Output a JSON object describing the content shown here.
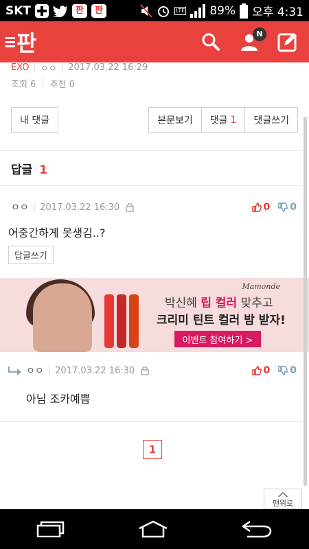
{
  "status_bar": {
    "carrier": "SKT",
    "battery": "89%",
    "time": "오후 4:31",
    "net_badge": "LTE"
  },
  "app": {
    "logo": "판",
    "notification_badge": "N"
  },
  "post_meta": {
    "category": "EXO",
    "author": "ㅇㅇ",
    "date": "2017.03.22 16:29",
    "views": "조회 6",
    "recommend": "추천 0"
  },
  "buttons": {
    "my_comments": "내 댓글",
    "view_post": "본문보기",
    "comments_label": "댓글",
    "comments_count": "1",
    "write_comment": "댓글쓰기"
  },
  "replies": {
    "heading": "답글",
    "count": "1"
  },
  "comment1": {
    "author": "ㅇㅇ",
    "date": "2017.03.22 16:30",
    "up": "0",
    "down": "0",
    "text": "어중간하게 못생김..?",
    "reply_button": "답글쓰기"
  },
  "ad": {
    "brand": "Mamonde",
    "line1_a": "박신혜 ",
    "line1_hl": "립 컬러",
    "line1_b": " 맞추고",
    "line2": "크리미 틴트 컬러 밤 받자!",
    "cta": "이벤트 참여하기 >"
  },
  "comment2": {
    "author": "ㅇㅇ",
    "date": "2017.03.22 16:30",
    "up": "0",
    "down": "0",
    "text": "아님 조카예쁨"
  },
  "pager": {
    "current": "1"
  },
  "top_button": {
    "label": "맨위로"
  },
  "colors": {
    "brand_red": "#e9413e",
    "ad_pink": "#d81b60"
  }
}
